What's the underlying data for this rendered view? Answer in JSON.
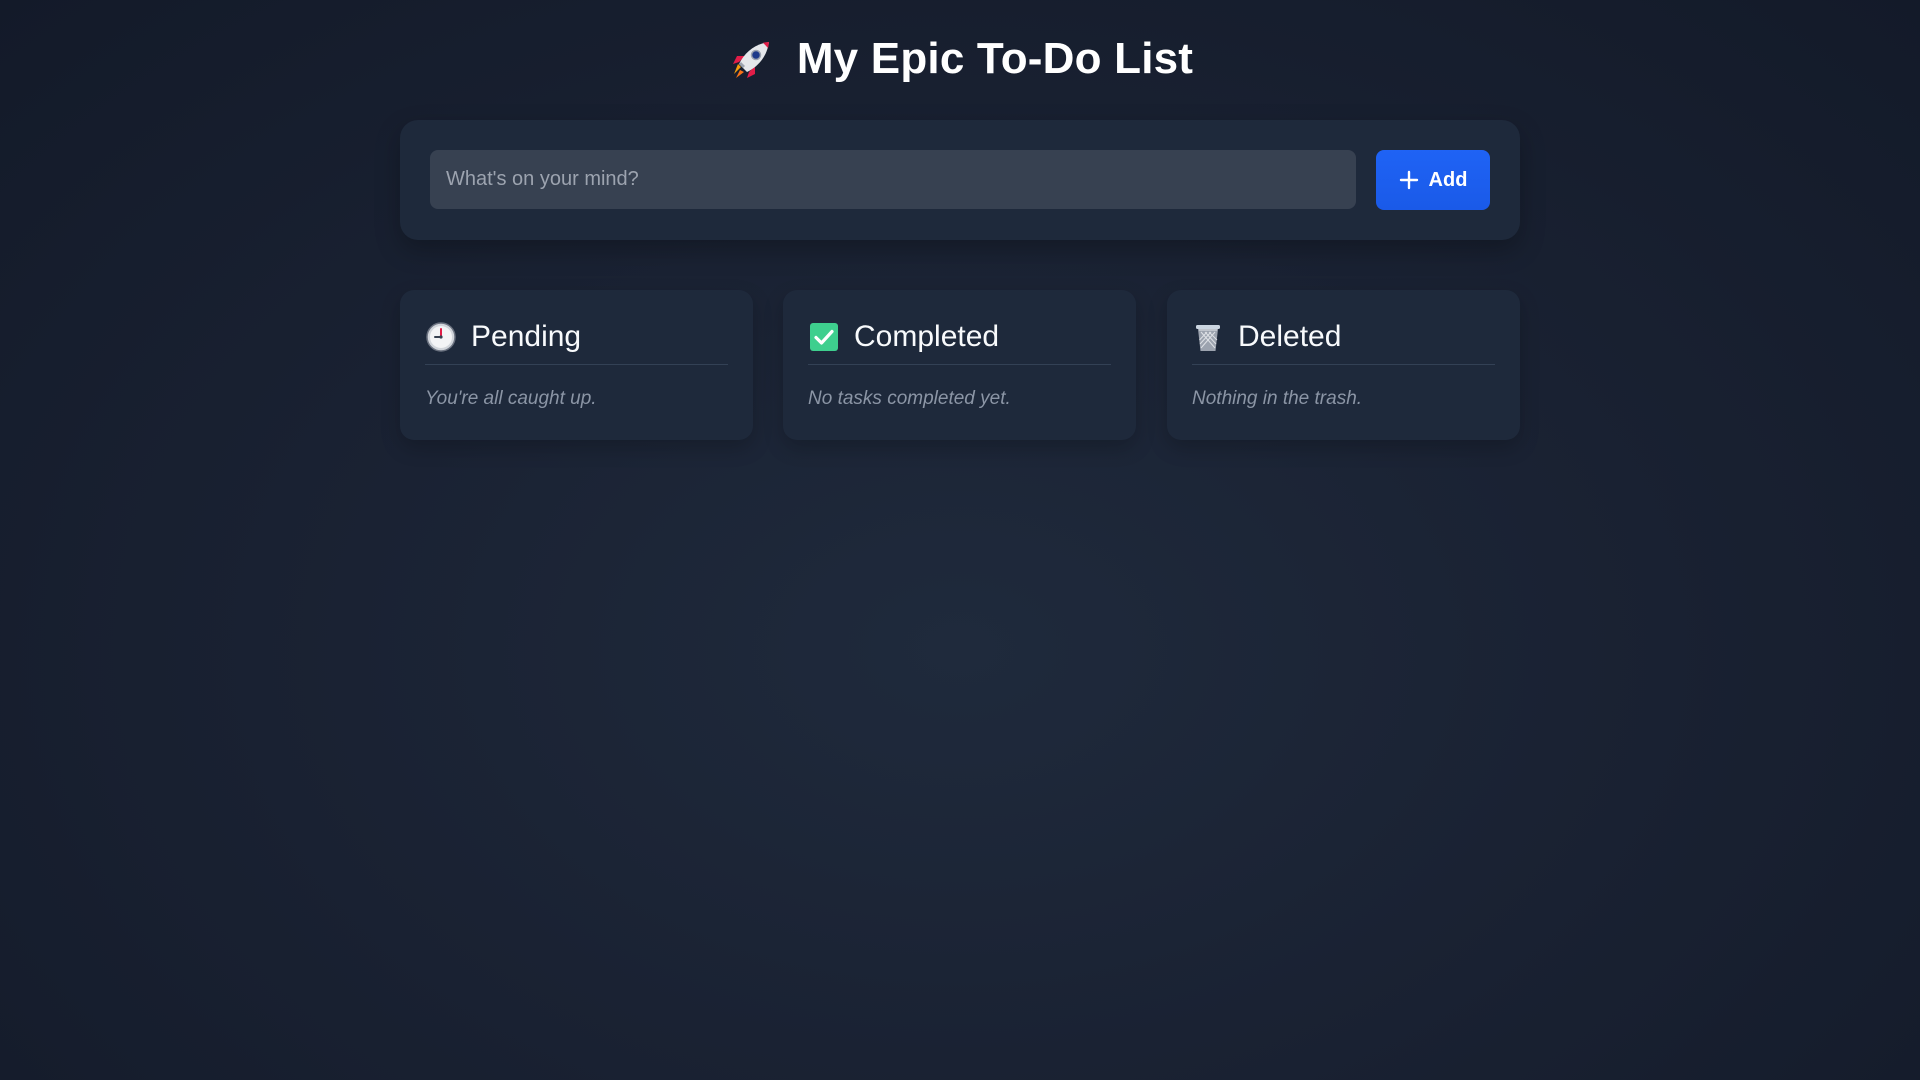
{
  "header": {
    "icon": "rocket-icon",
    "title": "My Epic To-Do List"
  },
  "add_form": {
    "input_placeholder": "What's on your mind?",
    "input_value": "",
    "add_button_icon": "plus-icon",
    "add_button_label": "Add"
  },
  "columns": [
    {
      "icon": "clock-icon",
      "title": "Pending",
      "empty_message": "You're all caught up."
    },
    {
      "icon": "check-box-icon",
      "title": "Completed",
      "empty_message": "No tasks completed yet."
    },
    {
      "icon": "trash-icon",
      "title": "Deleted",
      "empty_message": "Nothing in the trash."
    }
  ],
  "colors": {
    "background": "#1a2233",
    "panel": "#1e293b",
    "input": "#374151",
    "accent": "#2563eb",
    "completed_icon": "#3ecf8e",
    "muted_text": "#8b95a5"
  }
}
